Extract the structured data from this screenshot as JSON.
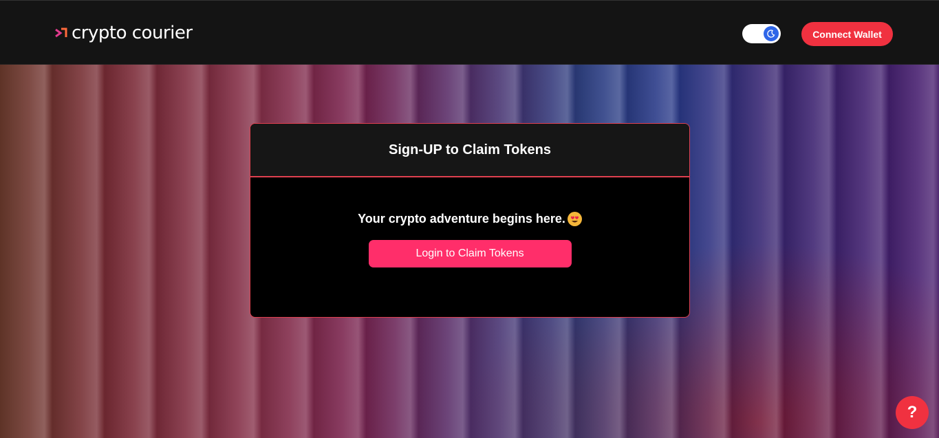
{
  "header": {
    "logo_text": "crypto courier",
    "logo_icon": "crypto-courier-logo-icon",
    "theme_toggle_icon": "moon-icon",
    "connect_wallet_label": "Connect Wallet",
    "colors": {
      "accent": "#f03140",
      "toggle_knob": "#2f66e8"
    }
  },
  "card": {
    "title": "Sign-UP to Claim Tokens",
    "tagline": "Your crypto adventure begins here.",
    "tagline_emoji_icon": "heart-eyes-emoji-icon",
    "login_button_label": "Login to Claim Tokens",
    "colors": {
      "border": "#e0404f",
      "button": "#ff2e6a"
    }
  },
  "help": {
    "label": "?"
  }
}
